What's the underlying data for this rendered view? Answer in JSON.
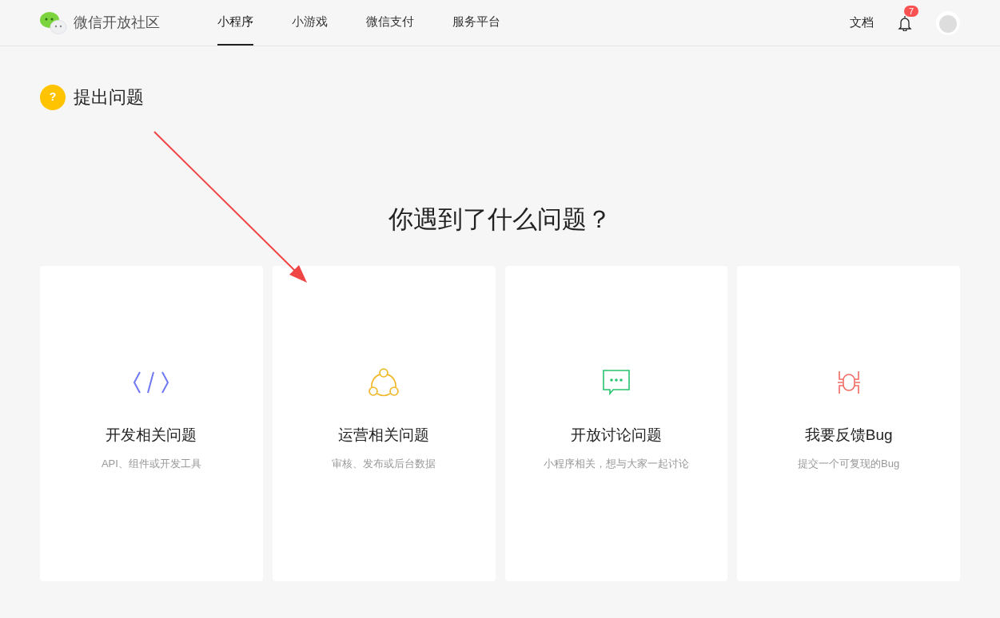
{
  "header": {
    "site_name": "微信开放社区",
    "nav": [
      {
        "label": "小程序",
        "selected": true
      },
      {
        "label": "小游戏",
        "selected": false
      },
      {
        "label": "微信支付",
        "selected": false
      },
      {
        "label": "服务平台",
        "selected": false
      }
    ],
    "docs": "文档",
    "notification_count": "7"
  },
  "page": {
    "title_icon": "?",
    "title": "提出问题",
    "question": "你遇到了什么问题？"
  },
  "cards": [
    {
      "kind": "code",
      "title": "开发相关问题",
      "subtitle": "API、组件或开发工具"
    },
    {
      "kind": "share",
      "title": "运营相关问题",
      "subtitle": "审核、发布或后台数据"
    },
    {
      "kind": "chat",
      "title": "开放讨论问题",
      "subtitle": "小程序相关，想与大家一起讨论"
    },
    {
      "kind": "bug",
      "title": "我要反馈Bug",
      "subtitle": "提交一个可复现的Bug"
    }
  ]
}
